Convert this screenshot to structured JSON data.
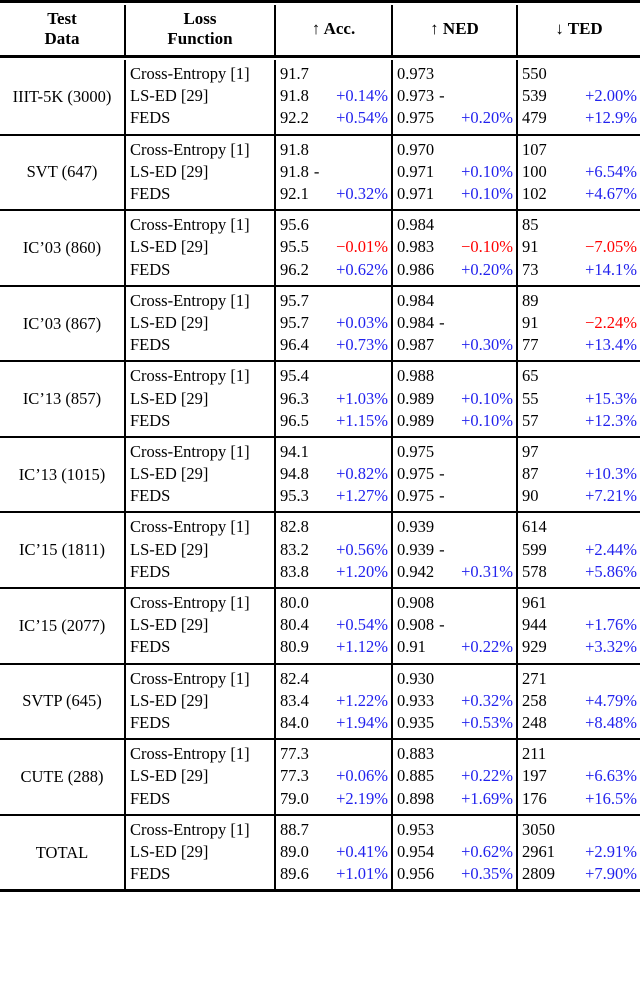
{
  "table": {
    "columns": [
      {
        "id": "test_data",
        "label_lines": [
          "Test",
          "Data"
        ],
        "arrow": ""
      },
      {
        "id": "loss_function",
        "label_lines": [
          "Loss",
          "Function"
        ],
        "arrow": ""
      },
      {
        "id": "acc",
        "label_lines": [
          "Acc."
        ],
        "arrow": "↑",
        "label": "↑ Acc."
      },
      {
        "id": "ned",
        "label_lines": [
          "NED"
        ],
        "arrow": "↑",
        "label": "↑ NED"
      },
      {
        "id": "ted",
        "label_lines": [
          "TED"
        ],
        "arrow": "↓",
        "label": "↓ TED"
      }
    ],
    "loss_functions": [
      "Cross-Entropy [1]",
      "LS-ED [29]",
      "FEDS"
    ],
    "colors": {
      "improvement": "#2222ee",
      "degradation": "#ff0000",
      "neutral": "#000000"
    },
    "groups": [
      {
        "name": "IIIT-5K (3000)",
        "rows": [
          {
            "loss": "Cross-Entropy [1]",
            "acc": "91.7",
            "acc_delta": "",
            "acc_dir": "neutral",
            "ned": "0.973",
            "ned_delta": "",
            "ned_dir": "neutral",
            "ted": "550",
            "ted_delta": "",
            "ted_dir": "neutral"
          },
          {
            "loss": "LS-ED [29]",
            "acc": "91.8",
            "acc_delta": "+0.14%",
            "acc_dir": "up",
            "ned": "0.973",
            "ned_delta": "-",
            "ned_dir": "dash",
            "ted": "539",
            "ted_delta": "+2.00%",
            "ted_dir": "up"
          },
          {
            "loss": "FEDS",
            "acc": "92.2",
            "acc_delta": "+0.54%",
            "acc_dir": "up",
            "ned": "0.975",
            "ned_delta": "+0.20%",
            "ned_dir": "up",
            "ted": "479",
            "ted_delta": "+12.9%",
            "ted_dir": "up"
          }
        ]
      },
      {
        "name": "SVT (647)",
        "rows": [
          {
            "loss": "Cross-Entropy [1]",
            "acc": "91.8",
            "acc_delta": "",
            "acc_dir": "neutral",
            "ned": "0.970",
            "ned_delta": "",
            "ned_dir": "neutral",
            "ted": "107",
            "ted_delta": "",
            "ted_dir": "neutral"
          },
          {
            "loss": "LS-ED [29]",
            "acc": "91.8",
            "acc_delta": "-",
            "acc_dir": "dash",
            "ned": "0.971",
            "ned_delta": "+0.10%",
            "ned_dir": "up",
            "ted": "100",
            "ted_delta": "+6.54%",
            "ted_dir": "up"
          },
          {
            "loss": "FEDS",
            "acc": "92.1",
            "acc_delta": "+0.32%",
            "acc_dir": "up",
            "ned": "0.971",
            "ned_delta": "+0.10%",
            "ned_dir": "up",
            "ted": "102",
            "ted_delta": "+4.67%",
            "ted_dir": "up"
          }
        ]
      },
      {
        "name": "IC’03 (860)",
        "rows": [
          {
            "loss": "Cross-Entropy [1]",
            "acc": "95.6",
            "acc_delta": "",
            "acc_dir": "neutral",
            "ned": "0.984",
            "ned_delta": "",
            "ned_dir": "neutral",
            "ted": "85",
            "ted_delta": "",
            "ted_dir": "neutral"
          },
          {
            "loss": "LS-ED [29]",
            "acc": "95.5",
            "acc_delta": "−0.01%",
            "acc_dir": "down",
            "ned": "0.983",
            "ned_delta": "−0.10%",
            "ned_dir": "down",
            "ted": "91",
            "ted_delta": "−7.05%",
            "ted_dir": "down"
          },
          {
            "loss": "FEDS",
            "acc": "96.2",
            "acc_delta": "+0.62%",
            "acc_dir": "up",
            "ned": "0.986",
            "ned_delta": "+0.20%",
            "ned_dir": "up",
            "ted": "73",
            "ted_delta": "+14.1%",
            "ted_dir": "up"
          }
        ]
      },
      {
        "name": "IC’03 (867)",
        "rows": [
          {
            "loss": "Cross-Entropy [1]",
            "acc": "95.7",
            "acc_delta": "",
            "acc_dir": "neutral",
            "ned": "0.984",
            "ned_delta": "",
            "ned_dir": "neutral",
            "ted": "89",
            "ted_delta": "",
            "ted_dir": "neutral"
          },
          {
            "loss": "LS-ED [29]",
            "acc": "95.7",
            "acc_delta": "+0.03%",
            "acc_dir": "up",
            "ned": "0.984",
            "ned_delta": "-",
            "ned_dir": "dash",
            "ted": "91",
            "ted_delta": "−2.24%",
            "ted_dir": "down"
          },
          {
            "loss": "FEDS",
            "acc": "96.4",
            "acc_delta": "+0.73%",
            "acc_dir": "up",
            "ned": "0.987",
            "ned_delta": "+0.30%",
            "ned_dir": "up",
            "ted": "77",
            "ted_delta": "+13.4%",
            "ted_dir": "up"
          }
        ]
      },
      {
        "name": "IC’13 (857)",
        "rows": [
          {
            "loss": "Cross-Entropy [1]",
            "acc": "95.4",
            "acc_delta": "",
            "acc_dir": "neutral",
            "ned": "0.988",
            "ned_delta": "",
            "ned_dir": "neutral",
            "ted": "65",
            "ted_delta": "",
            "ted_dir": "neutral"
          },
          {
            "loss": "LS-ED [29]",
            "acc": "96.3",
            "acc_delta": "+1.03%",
            "acc_dir": "up",
            "ned": "0.989",
            "ned_delta": "+0.10%",
            "ned_dir": "up",
            "ted": "55",
            "ted_delta": "+15.3%",
            "ted_dir": "up"
          },
          {
            "loss": "FEDS",
            "acc": "96.5",
            "acc_delta": "+1.15%",
            "acc_dir": "up",
            "ned": "0.989",
            "ned_delta": "+0.10%",
            "ned_dir": "up",
            "ted": "57",
            "ted_delta": "+12.3%",
            "ted_dir": "up"
          }
        ]
      },
      {
        "name": "IC’13 (1015)",
        "rows": [
          {
            "loss": "Cross-Entropy [1]",
            "acc": "94.1",
            "acc_delta": "",
            "acc_dir": "neutral",
            "ned": "0.975",
            "ned_delta": "",
            "ned_dir": "neutral",
            "ted": "97",
            "ted_delta": "",
            "ted_dir": "neutral"
          },
          {
            "loss": "LS-ED [29]",
            "acc": "94.8",
            "acc_delta": "+0.82%",
            "acc_dir": "up",
            "ned": "0.975",
            "ned_delta": "-",
            "ned_dir": "dash",
            "ted": "87",
            "ted_delta": "+10.3%",
            "ted_dir": "up"
          },
          {
            "loss": "FEDS",
            "acc": "95.3",
            "acc_delta": "+1.27%",
            "acc_dir": "up",
            "ned": "0.975",
            "ned_delta": "-",
            "ned_dir": "dash",
            "ted": "90",
            "ted_delta": "+7.21%",
            "ted_dir": "up"
          }
        ]
      },
      {
        "name": "IC’15 (1811)",
        "rows": [
          {
            "loss": "Cross-Entropy [1]",
            "acc": "82.8",
            "acc_delta": "",
            "acc_dir": "neutral",
            "ned": "0.939",
            "ned_delta": "",
            "ned_dir": "neutral",
            "ted": "614",
            "ted_delta": "",
            "ted_dir": "neutral"
          },
          {
            "loss": "LS-ED [29]",
            "acc": "83.2",
            "acc_delta": "+0.56%",
            "acc_dir": "up",
            "ned": "0.939",
            "ned_delta": "-",
            "ned_dir": "dash",
            "ted": "599",
            "ted_delta": "+2.44%",
            "ted_dir": "up"
          },
          {
            "loss": "FEDS",
            "acc": "83.8",
            "acc_delta": "+1.20%",
            "acc_dir": "up",
            "ned": "0.942",
            "ned_delta": "+0.31%",
            "ned_dir": "up",
            "ted": "578",
            "ted_delta": "+5.86%",
            "ted_dir": "up"
          }
        ]
      },
      {
        "name": "IC’15 (2077)",
        "rows": [
          {
            "loss": "Cross-Entropy [1]",
            "acc": "80.0",
            "acc_delta": "",
            "acc_dir": "neutral",
            "ned": "0.908",
            "ned_delta": "",
            "ned_dir": "neutral",
            "ted": "961",
            "ted_delta": "",
            "ted_dir": "neutral"
          },
          {
            "loss": "LS-ED [29]",
            "acc": "80.4",
            "acc_delta": "+0.54%",
            "acc_dir": "up",
            "ned": "0.908",
            "ned_delta": "-",
            "ned_dir": "dash",
            "ted": "944",
            "ted_delta": "+1.76%",
            "ted_dir": "up"
          },
          {
            "loss": "FEDS",
            "acc": "80.9",
            "acc_delta": "+1.12%",
            "acc_dir": "up",
            "ned": "0.91",
            "ned_delta": "+0.22%",
            "ned_dir": "up",
            "ted": "929",
            "ted_delta": "+3.32%",
            "ted_dir": "up"
          }
        ]
      },
      {
        "name": "SVTP (645)",
        "rows": [
          {
            "loss": "Cross-Entropy [1]",
            "acc": "82.4",
            "acc_delta": "",
            "acc_dir": "neutral",
            "ned": "0.930",
            "ned_delta": "",
            "ned_dir": "neutral",
            "ted": "271",
            "ted_delta": "",
            "ted_dir": "neutral"
          },
          {
            "loss": "LS-ED [29]",
            "acc": "83.4",
            "acc_delta": "+1.22%",
            "acc_dir": "up",
            "ned": "0.933",
            "ned_delta": "+0.32%",
            "ned_dir": "up",
            "ted": "258",
            "ted_delta": "+4.79%",
            "ted_dir": "up"
          },
          {
            "loss": "FEDS",
            "acc": "84.0",
            "acc_delta": "+1.94%",
            "acc_dir": "up",
            "ned": "0.935",
            "ned_delta": "+0.53%",
            "ned_dir": "up",
            "ted": "248",
            "ted_delta": "+8.48%",
            "ted_dir": "up"
          }
        ]
      },
      {
        "name": "CUTE (288)",
        "rows": [
          {
            "loss": "Cross-Entropy [1]",
            "acc": "77.3",
            "acc_delta": "",
            "acc_dir": "neutral",
            "ned": "0.883",
            "ned_delta": "",
            "ned_dir": "neutral",
            "ted": "211",
            "ted_delta": "",
            "ted_dir": "neutral"
          },
          {
            "loss": "LS-ED [29]",
            "acc": "77.3",
            "acc_delta": "+0.06%",
            "acc_dir": "up",
            "ned": "0.885",
            "ned_delta": "+0.22%",
            "ned_dir": "up",
            "ted": "197",
            "ted_delta": "+6.63%",
            "ted_dir": "up"
          },
          {
            "loss": "FEDS",
            "acc": "79.0",
            "acc_delta": "+2.19%",
            "acc_dir": "up",
            "ned": "0.898",
            "ned_delta": "+1.69%",
            "ned_dir": "up",
            "ted": "176",
            "ted_delta": "+16.5%",
            "ted_dir": "up"
          }
        ]
      },
      {
        "name": "TOTAL",
        "rows": [
          {
            "loss": "Cross-Entropy [1]",
            "acc": "88.7",
            "acc_delta": "",
            "acc_dir": "neutral",
            "ned": "0.953",
            "ned_delta": "",
            "ned_dir": "neutral",
            "ted": "3050",
            "ted_delta": "",
            "ted_dir": "neutral"
          },
          {
            "loss": "LS-ED [29]",
            "acc": "89.0",
            "acc_delta": "+0.41%",
            "acc_dir": "up",
            "ned": "0.954",
            "ned_delta": "+0.62%",
            "ned_dir": "up",
            "ted": "2961",
            "ted_delta": "+2.91%",
            "ted_dir": "up"
          },
          {
            "loss": "FEDS",
            "acc": "89.6",
            "acc_delta": "+1.01%",
            "acc_dir": "up",
            "ned": "0.956",
            "ned_delta": "+0.35%",
            "ned_dir": "up",
            "ted": "2809",
            "ted_delta": "+7.90%",
            "ted_dir": "up"
          }
        ]
      }
    ]
  }
}
